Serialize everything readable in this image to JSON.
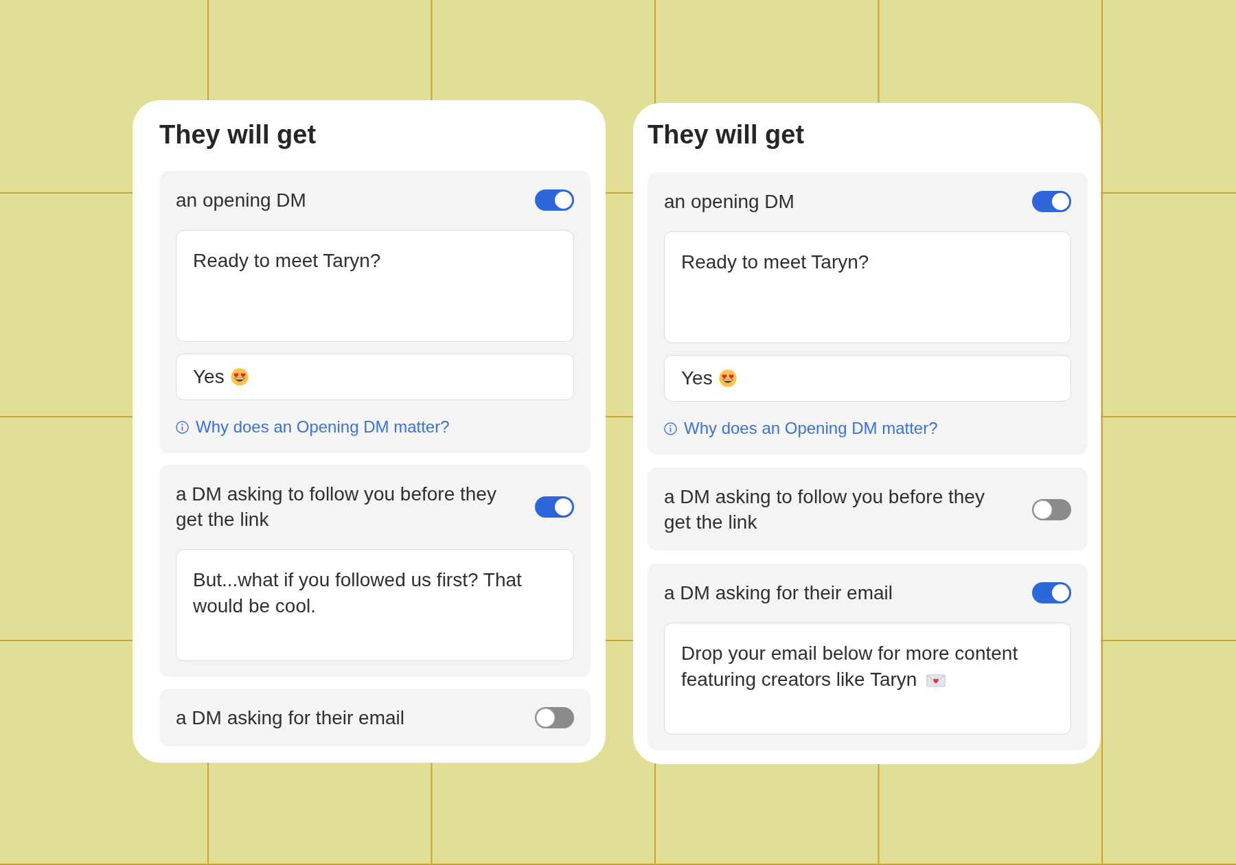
{
  "cards": [
    {
      "title": "They will get",
      "sections": [
        {
          "label": "an opening DM",
          "enabled": true,
          "message": {
            "value": "Ready to meet Taryn?"
          },
          "reply": {
            "value": "Yes",
            "emoji": {
              "kind": "heart_eyes"
            }
          },
          "help_link": "Why does an Opening DM matter?"
        },
        {
          "label": "a DM asking to follow you before they get the link",
          "enabled": true,
          "message": {
            "value": "But...what if you followed us first? That would be cool."
          }
        },
        {
          "label": "a DM asking for their email",
          "enabled": false
        }
      ]
    },
    {
      "title": "They will get",
      "sections": [
        {
          "label": "an opening DM",
          "enabled": true,
          "message": {
            "value": "Ready to meet Taryn?"
          },
          "reply": {
            "value": "Yes",
            "emoji": {
              "kind": "heart_eyes"
            }
          },
          "help_link": "Why does an Opening DM matter?"
        },
        {
          "label": "a DM asking to follow you before they get the link",
          "enabled": false
        },
        {
          "label": "a DM asking for their email",
          "enabled": true,
          "message": {
            "value": "Drop your email below for more content featuring creators like Taryn",
            "emoji": {
              "kind": "love_letter"
            }
          }
        }
      ]
    }
  ]
}
